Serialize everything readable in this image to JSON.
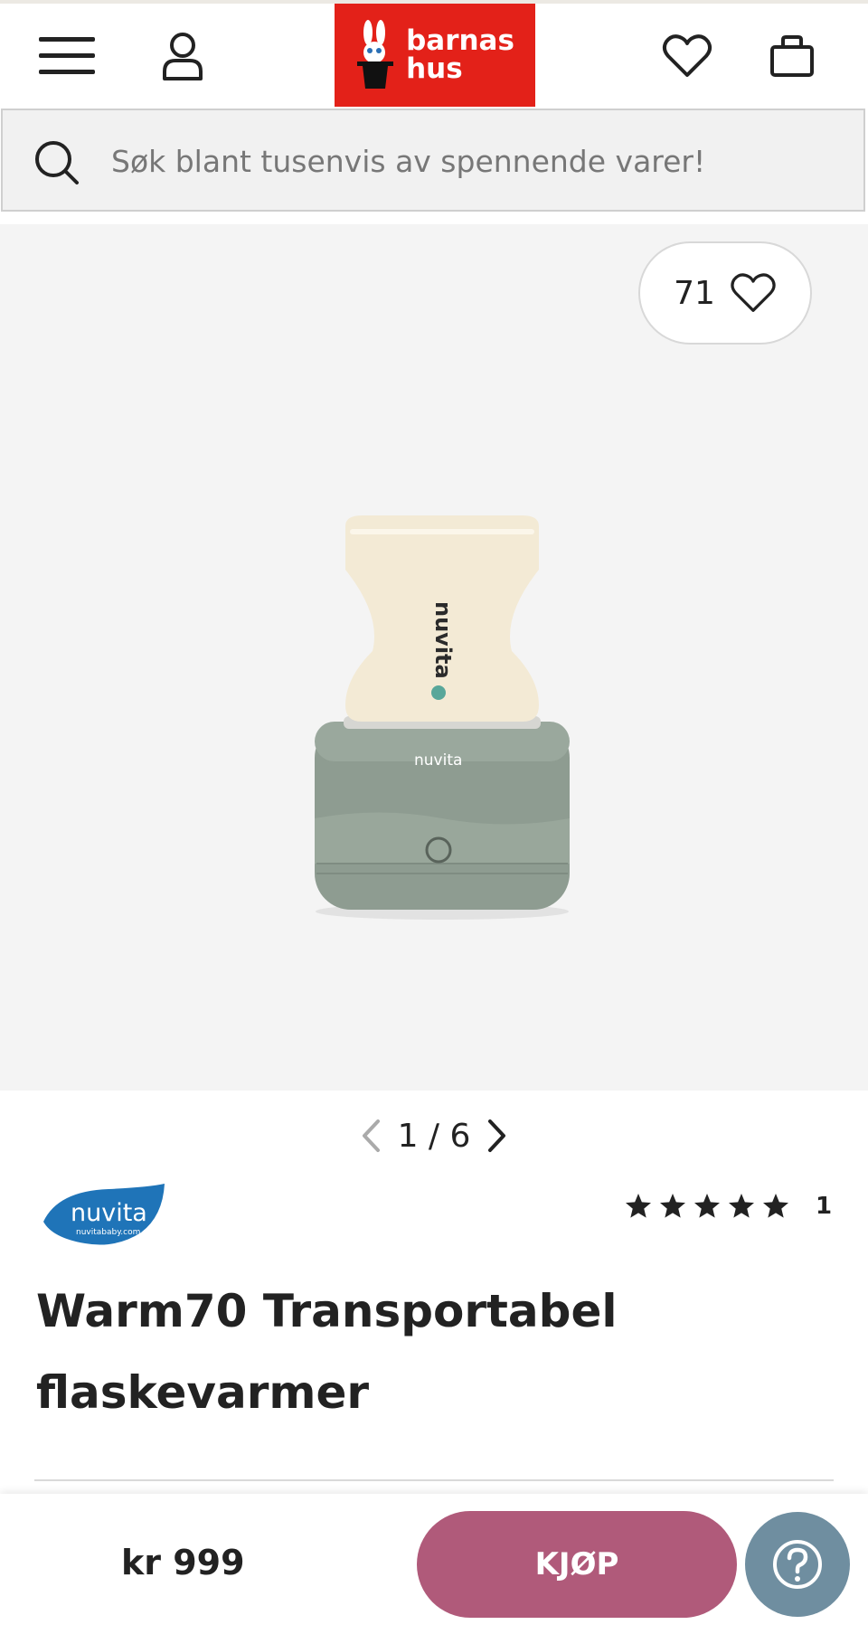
{
  "header": {
    "logo_line1": "barnas",
    "logo_line2": "hus",
    "icons": [
      "menu-icon",
      "account-icon",
      "heart-icon",
      "bag-icon"
    ]
  },
  "search": {
    "placeholder": "Søk blant tusenvis av spennende varer!"
  },
  "gallery": {
    "wishlist_count": "71",
    "page_indicator": "1 / 6",
    "product_image_text": "nuvita"
  },
  "product": {
    "brand": "nuvita",
    "brand_url": "nuvitababy.com",
    "rating_stars": 5,
    "rating_count": "1",
    "title": "Warm70 Transportabel flaskevarmer"
  },
  "purchase": {
    "price": "kr 999",
    "buy_label": "KJØP"
  },
  "colors": {
    "logo_red": "#e32119",
    "buy_button": "#b05a7a",
    "help_button": "#6f8ea0",
    "gallery_bg": "#f4f4f4"
  }
}
